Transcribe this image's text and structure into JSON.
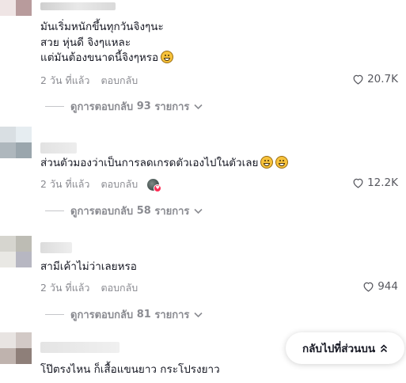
{
  "ui": {
    "time_ago": "2 วัน ที่แล้ว",
    "reply_label": "ตอบกลับ",
    "view_replies_prefix": "ดูการตอบกลับ",
    "replies_suffix": "รายการ",
    "back_to_top": "กลับไปที่ส่วนบน"
  },
  "comments": [
    {
      "lines": [
        "มันเริ่มหนักขึ้นทุกวันจิงๆนะ",
        "สวย หุ่นดี จิงๆแหละ",
        "แต่มันต้องขนาดนี้จิงๆหรอ"
      ],
      "emojis": [
        "grinning-sweat-emoji"
      ],
      "time": "2 วัน ที่แล้ว",
      "likes": "20.7K",
      "reply_count": "93"
    },
    {
      "lines": [
        "ส่วนตัวมองว่าเป็นการลดเกรดตัวเองไปในตัวเลย"
      ],
      "emojis": [
        "grinning-emoji",
        "grinning-emoji"
      ],
      "time": "2 วัน ที่แล้ว",
      "creator_liked": true,
      "likes": "12.2K",
      "reply_count": "58"
    },
    {
      "lines": [
        "สามีเค้าไม่ว่าเลยหรอ"
      ],
      "emojis": [],
      "time": "2 วัน ที่แล้ว",
      "likes": "944",
      "reply_count": "81"
    },
    {
      "lines": [
        "โป๊ตรงไหน ก็เสื้อแขนยาว กระโปรงยาว"
      ],
      "emojis": []
    }
  ],
  "colors": {
    "text_primary": "#161823",
    "text_secondary": "#8a8b91",
    "like_text": "#57585f",
    "creator_heart": "#fe2c55"
  }
}
